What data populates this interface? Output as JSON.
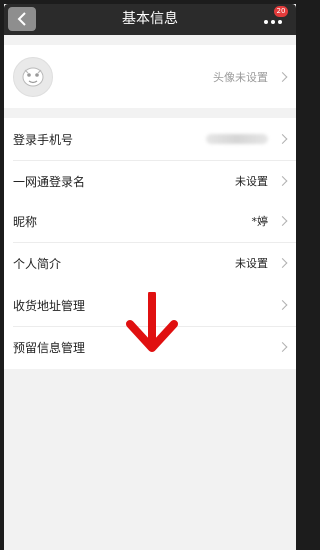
{
  "nav": {
    "title": "基本信息",
    "badge_count": "20"
  },
  "avatar_row": {
    "hint": "头像未设置"
  },
  "account": {
    "phone_label": "登录手机号",
    "login_name_label": "一网通登录名",
    "login_name_value": "未设置"
  },
  "profile": {
    "nickname_label": "昵称",
    "nickname_value": "*婷",
    "bio_label": "个人简介",
    "bio_value": "未设置"
  },
  "address": {
    "address_label": "收货地址管理",
    "reserved_label": "预留信息管理"
  },
  "colors": {
    "nav_bg": "#2b2b2b",
    "page_bg": "#f2f2f2",
    "badge": "#e23b3b",
    "annotation": "#e01010"
  },
  "icons": [
    "chevron-left-icon",
    "more-icon",
    "avatar-placeholder-icon",
    "chevron-right-icon",
    "down-arrow-annotation"
  ]
}
